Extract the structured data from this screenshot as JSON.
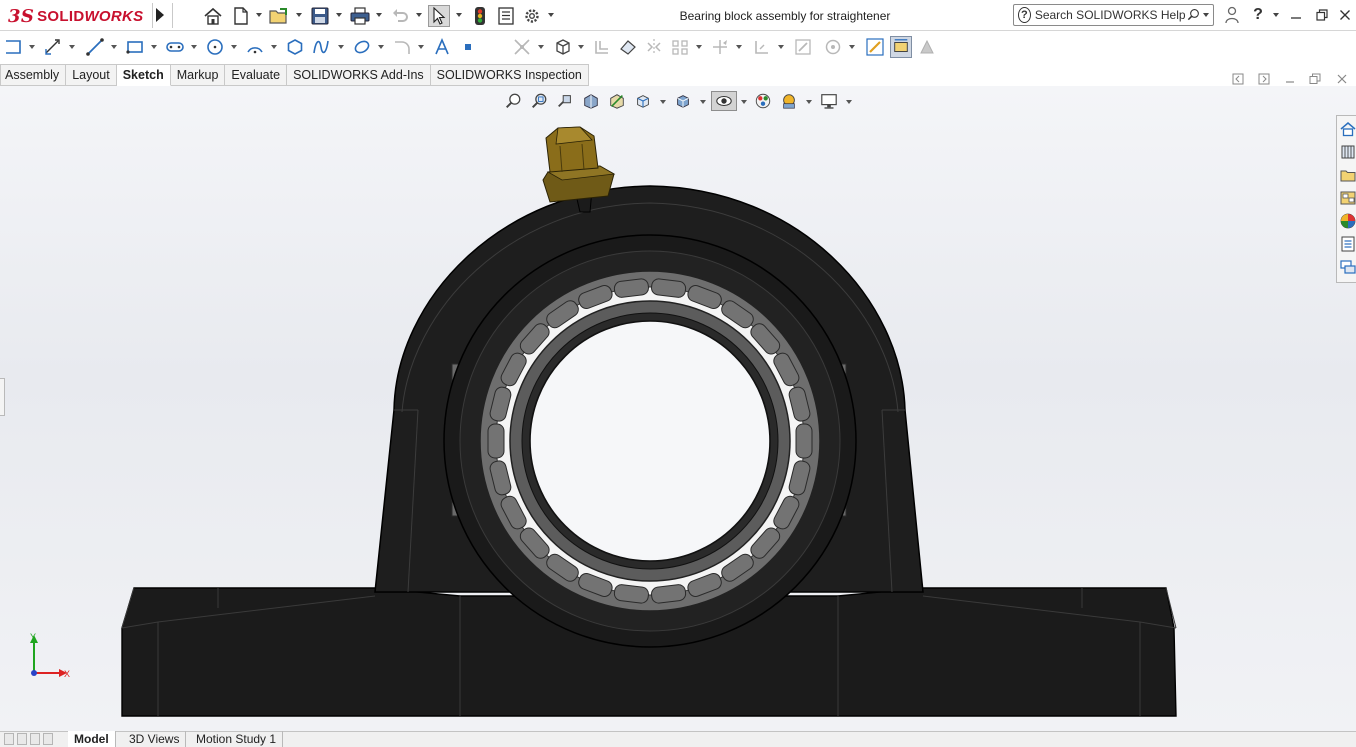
{
  "app": {
    "logo_ds": "3S",
    "logo_solid": "SOLID",
    "logo_works": "WORKS",
    "window_title": "Bearing block assembly for straightener",
    "help_placeholder": "Search SOLIDWORKS Help",
    "help_mark": "?",
    "help_icon_label": "?"
  },
  "tabs": [
    {
      "label": "Assembly"
    },
    {
      "label": "Layout"
    },
    {
      "label": "Sketch"
    },
    {
      "label": "Markup"
    },
    {
      "label": "Evaluate"
    },
    {
      "label": "SOLIDWORKS Add-Ins"
    },
    {
      "label": "SOLIDWORKS Inspection"
    }
  ],
  "active_tab": "Sketch",
  "triad": {
    "y": "Y",
    "x": "X"
  },
  "bottom_tabs": [
    {
      "label": "Model"
    },
    {
      "label": "3D Views"
    },
    {
      "label": "Motion Study 1"
    }
  ],
  "active_bottom_tab": "Model",
  "colors": {
    "brand": "#c8102e",
    "housing": "#1b1b1b",
    "bearing_steel": "#6e6e6e",
    "grease_fitting": "#8a6d1a",
    "viewport_bg": "#eceef2"
  }
}
